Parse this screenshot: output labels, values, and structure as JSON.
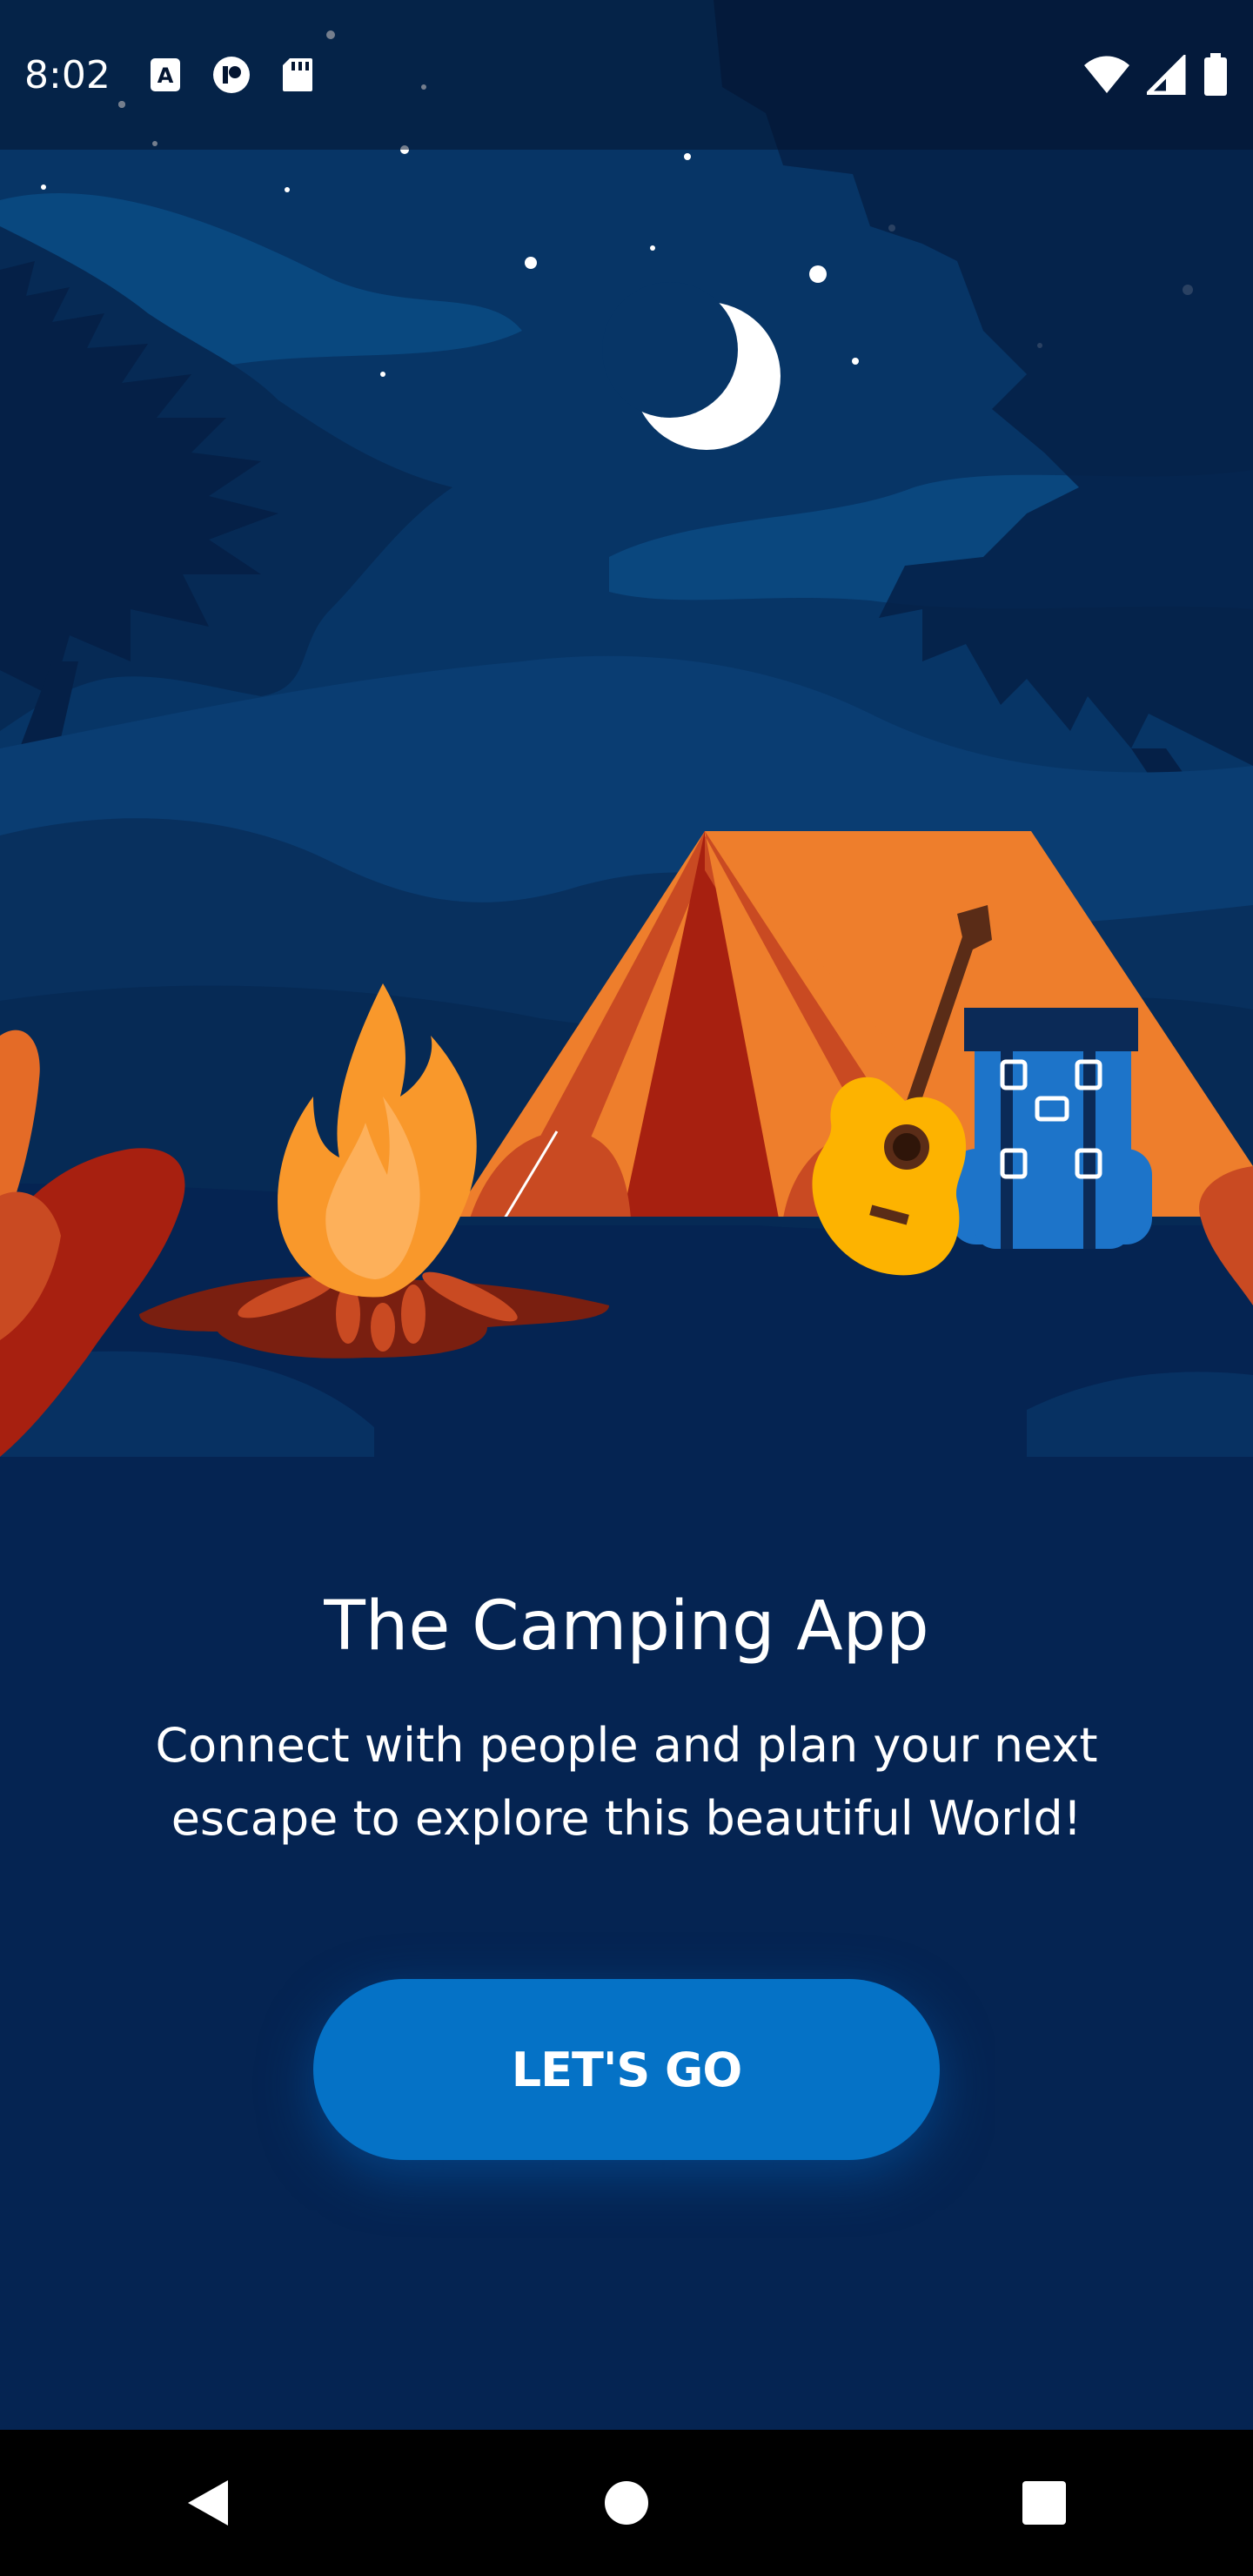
{
  "status_bar": {
    "time": "8:02",
    "left_icons": [
      "keyboard-a-icon",
      "media-app-icon",
      "sd-card-icon"
    ],
    "right_icons": [
      "wifi-icon",
      "signal-icon",
      "battery-icon"
    ]
  },
  "main": {
    "title": "The Camping App",
    "subtitle": "Connect with people and plan your next escape to explore this beautiful World!",
    "cta_label": "LET'S GO"
  },
  "nav_bar": {
    "icons": [
      "back-icon",
      "home-icon",
      "recents-icon"
    ]
  },
  "colors": {
    "background": "#052452",
    "sky": "#073566",
    "cta": "#0572c6",
    "tent": "#ee7e2c",
    "fire": "#f9982b",
    "backpack": "#1d74c9",
    "guitar": "#fdb300"
  }
}
